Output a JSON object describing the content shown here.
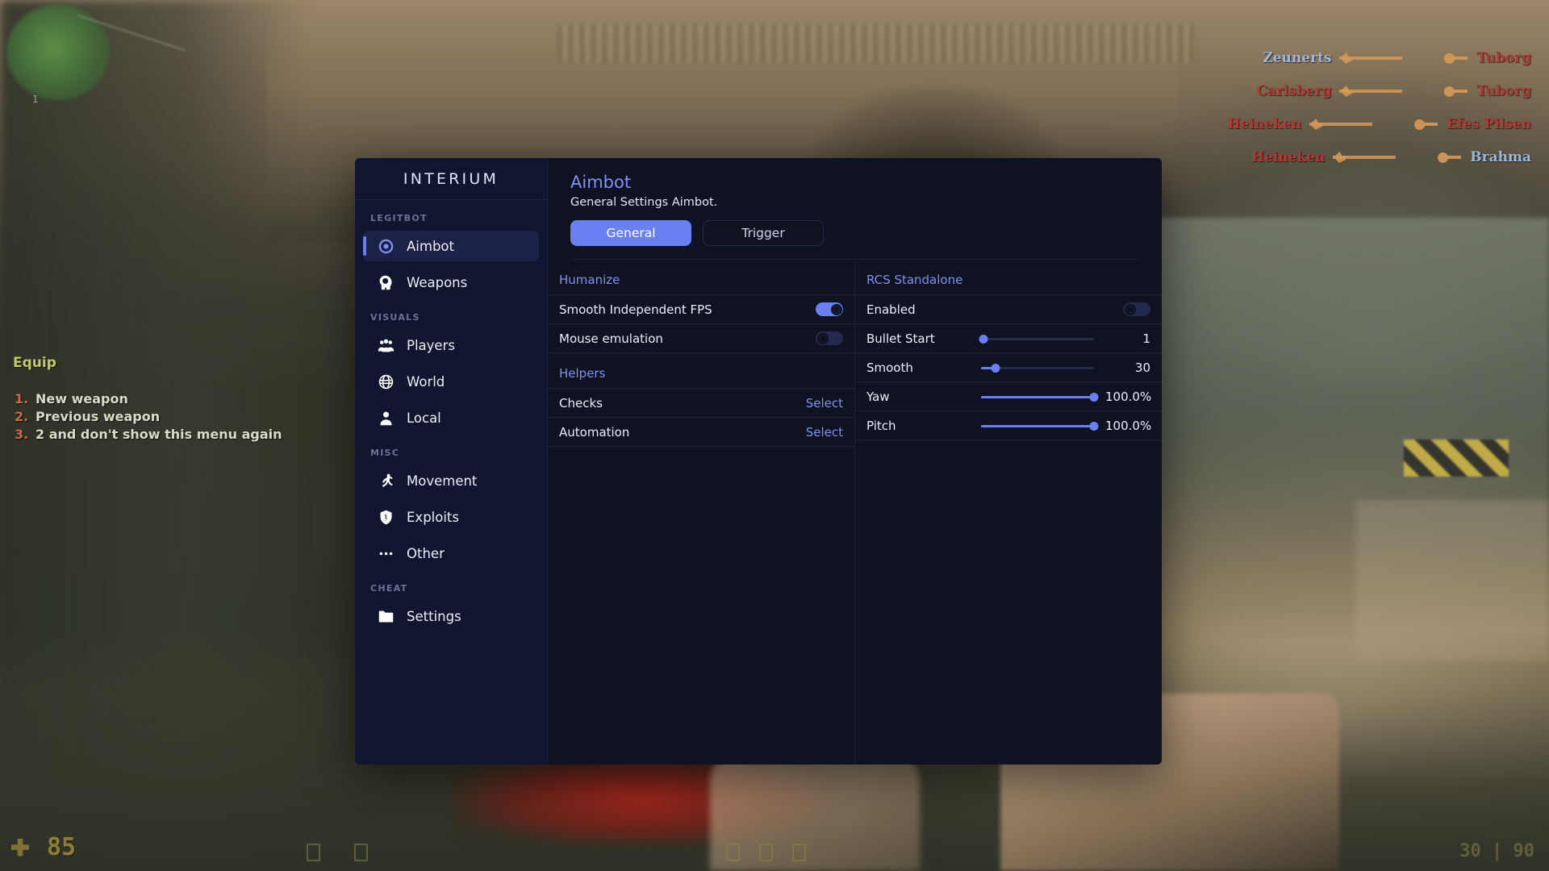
{
  "game_hud": {
    "equip_title": "Equip",
    "equip_options": [
      {
        "num": "1.",
        "text": "New weapon"
      },
      {
        "num": "2.",
        "text": "Previous weapon"
      },
      {
        "num": "3.",
        "text": "2 and don't show this menu again"
      }
    ],
    "radar_tick": "1",
    "health": "85",
    "killfeed": [
      {
        "killer": "Zeunerts",
        "killer_team": "ct",
        "victim": "Tuborg",
        "victim_team": "t"
      },
      {
        "killer": "Carlsberg",
        "killer_team": "t",
        "victim": "Tuborg",
        "victim_team": "t"
      },
      {
        "killer": "Heineken",
        "killer_team": "t",
        "victim": "Efes Pilsen",
        "victim_team": "t"
      },
      {
        "killer": "Heineken",
        "killer_team": "t",
        "victim": "Brahma",
        "victim_team": "ct"
      }
    ],
    "ammo": "30 | 90"
  },
  "menu": {
    "brand": "INTERIUM",
    "sidebar": {
      "groups": [
        {
          "label": "LEGITBOT",
          "items": [
            {
              "label": "Aimbot",
              "icon": "crosshair-icon",
              "active": true
            },
            {
              "label": "Weapons",
              "icon": "head-target-icon",
              "active": false
            }
          ]
        },
        {
          "label": "VISUALS",
          "items": [
            {
              "label": "Players",
              "icon": "people-icon",
              "active": false
            },
            {
              "label": "World",
              "icon": "globe-icon",
              "active": false
            },
            {
              "label": "Local",
              "icon": "person-icon",
              "active": false
            }
          ]
        },
        {
          "label": "MISC",
          "items": [
            {
              "label": "Movement",
              "icon": "running-person-icon",
              "active": false
            },
            {
              "label": "Exploits",
              "icon": "cracked-shield-icon",
              "active": false
            },
            {
              "label": "Other",
              "icon": "ellipsis-icon",
              "active": false
            }
          ]
        },
        {
          "label": "CHEAT",
          "items": [
            {
              "label": "Settings",
              "icon": "folder-icon",
              "active": false
            }
          ]
        }
      ]
    },
    "page": {
      "title": "Aimbot",
      "subtitle": "General Settings Aimbot.",
      "tabs": [
        {
          "label": "General",
          "active": true
        },
        {
          "label": "Trigger",
          "active": false
        }
      ]
    },
    "left_column": {
      "sections": [
        {
          "title": "Humanize",
          "rows": [
            {
              "label": "Smooth Independent FPS",
              "control": "toggle",
              "value": "on"
            },
            {
              "label": "Mouse emulation",
              "control": "toggle",
              "value": "off"
            }
          ]
        },
        {
          "title": "Helpers",
          "rows": [
            {
              "label": "Checks",
              "control": "link",
              "value": "Select"
            },
            {
              "label": "Automation",
              "control": "link",
              "value": "Select"
            }
          ]
        }
      ]
    },
    "right_column": {
      "sections": [
        {
          "title": "RCS Standalone",
          "rows": [
            {
              "label": "Enabled",
              "control": "toggle",
              "value": "off"
            },
            {
              "label": "Bullet Start",
              "control": "slider",
              "value": "1",
              "percent": 2
            },
            {
              "label": "Smooth",
              "control": "slider",
              "value": "30",
              "percent": 13
            },
            {
              "label": "Yaw",
              "control": "slider",
              "value": "100.0%",
              "percent": 100
            },
            {
              "label": "Pitch",
              "control": "slider",
              "value": "100.0%",
              "percent": 100
            }
          ]
        }
      ]
    },
    "colors": {
      "accent": "#6b80f0",
      "accent_text": "#7f91f2",
      "panel_bg": "#0e1221",
      "sidebar_bg": "#111630",
      "divider": "#1b2140"
    }
  }
}
